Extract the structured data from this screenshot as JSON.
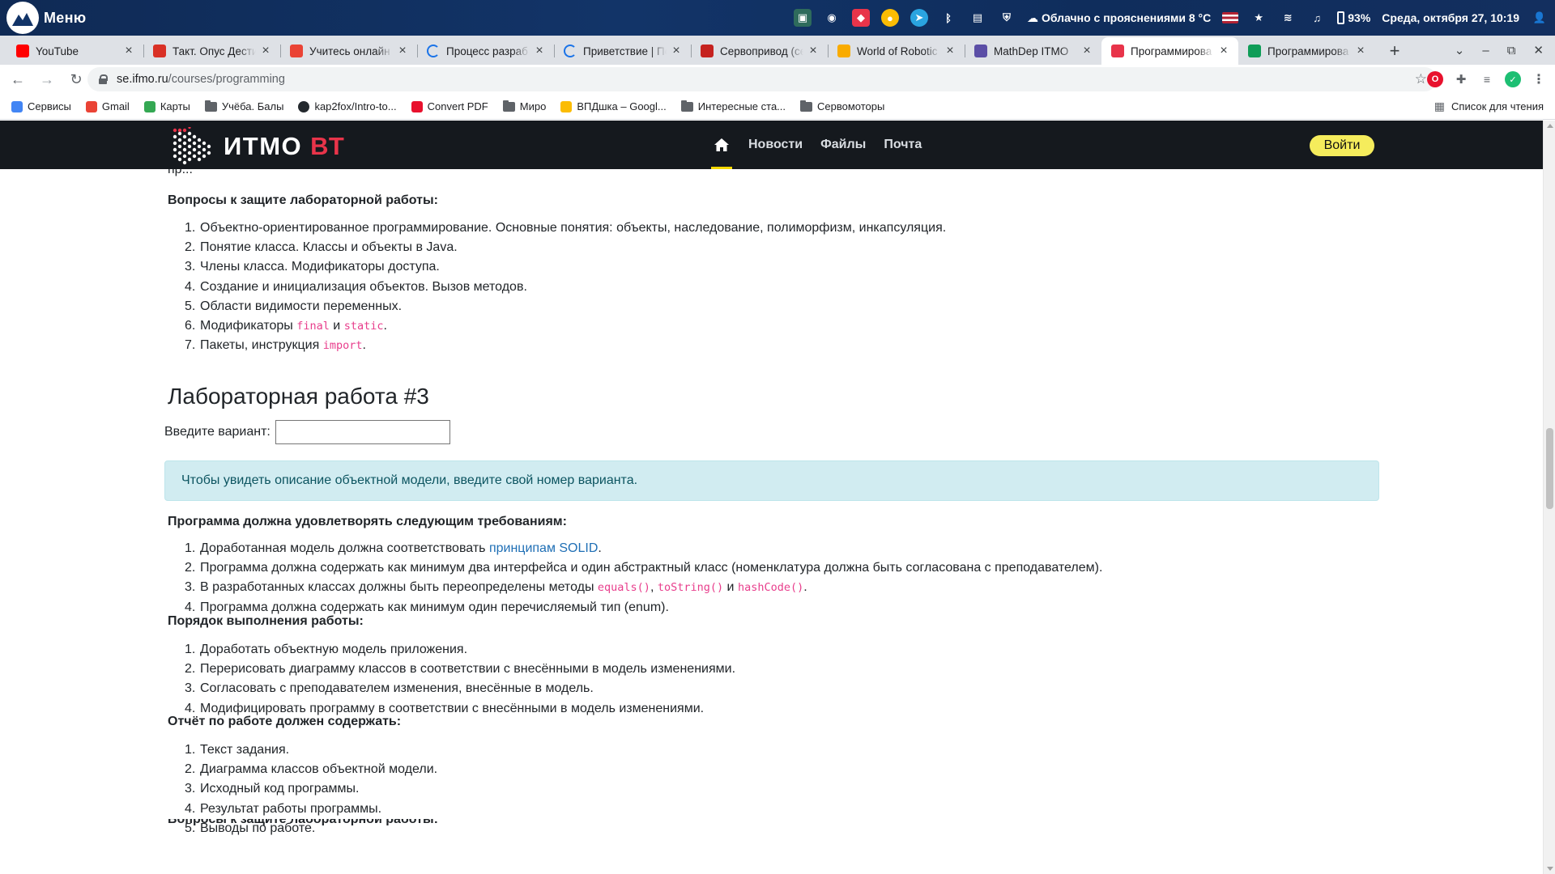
{
  "os": {
    "menu_label": "Меню",
    "weather": "Облачно с прояснениями 8 °C",
    "battery": "93%",
    "datetime": "Среда, октября 27, 10:19"
  },
  "tabs": [
    {
      "title": "YouTube",
      "icon": "youtube-icon",
      "color": "#ff0000"
    },
    {
      "title": "Такт. Опус Дести",
      "icon": "a-icon",
      "color": "#d93025"
    },
    {
      "title": "Учитесь онлайн",
      "icon": "gmail-icon",
      "color": "#ea4335"
    },
    {
      "title": "Процесс разраб",
      "icon": "loading-icon",
      "color": "#1a73e8"
    },
    {
      "title": "Приветствие | По",
      "icon": "loading-icon",
      "color": "#1a73e8"
    },
    {
      "title": "Сервопривод (се",
      "icon": "servo-icon",
      "color": "#c5221f"
    },
    {
      "title": "World of Robotic",
      "icon": "robotics-icon",
      "color": "#f9ab00"
    },
    {
      "title": "MathDep ITMO",
      "icon": "mathdep-icon",
      "color": "#5b4ea6"
    },
    {
      "title": "Программирова",
      "icon": "bt-icon",
      "color": "#e8344a",
      "active": true
    },
    {
      "title": "Программирова",
      "icon": "sheets-icon",
      "color": "#0f9d58"
    }
  ],
  "toolbar": {
    "url_host": "se.ifmo.ru",
    "url_path": "/courses/programming"
  },
  "bookmarks": [
    {
      "label": "Сервисы",
      "icon": "apps-grid-icon"
    },
    {
      "label": "Gmail",
      "icon": "gmail-icon"
    },
    {
      "label": "Карты",
      "icon": "maps-icon"
    },
    {
      "label": "Учёба. Балы",
      "icon": "folder-icon"
    },
    {
      "label": "kap2fox/Intro-to...",
      "icon": "github-icon"
    },
    {
      "label": "Convert PDF",
      "icon": "heart-icon"
    },
    {
      "label": "Миро",
      "icon": "folder-icon"
    },
    {
      "label": "ВПДшка – Googl...",
      "icon": "drive-icon"
    },
    {
      "label": "Интересные ста...",
      "icon": "folder-icon"
    },
    {
      "label": "Сервомоторы",
      "icon": "folder-icon"
    }
  ],
  "reading_list": "Список для чтения",
  "site": {
    "logo_text": "ИТМО",
    "logo_accent": "ВТ",
    "nav": [
      "Новости",
      "Файлы",
      "Почта"
    ],
    "login": "Войти"
  },
  "page": {
    "cut_top": "пр...",
    "defense_title": "Вопросы к защите лабораторной работы:",
    "defense": [
      "Объектно-ориентированное программирование. Основные понятия: объекты, наследование, полиморфизм, инкапсуляция.",
      "Понятие класса. Классы и объекты в Java.",
      "Члены класса. Модификаторы доступа.",
      "Создание и инициализация объектов. Вызов методов.",
      "Области видимости переменных."
    ],
    "defense6": {
      "pre": "Модификаторы ",
      "code1": "final",
      "mid": " и ",
      "code2": "static",
      "post": "."
    },
    "defense7": {
      "pre": "Пакеты, инструкция ",
      "code": "import",
      "post": "."
    },
    "lab_title": "Лабораторная работа #3",
    "variant_label": "Введите вариант:",
    "alert": "Чтобы увидеть описание объектной модели, введите свой номер варианта.",
    "req_title": "Программа должна удовлетворять следующим требованиям:",
    "req1": {
      "pre": "Доработанная модель должна соответствовать ",
      "link": "принципам SOLID",
      "post": "."
    },
    "req2": "Программа должна содержать как минимум два интерфейса и один абстрактный класс (номенклатура должна быть согласована с преподавателем).",
    "req3": {
      "pre": "В разработанных классах должны быть переопределены методы ",
      "c1": "equals()",
      "sep1": ", ",
      "c2": "toString()",
      "sep2": " и ",
      "c3": "hashCode()",
      "post": "."
    },
    "req4": "Программа должна содержать как минимум один перечисляемый тип (enum).",
    "order_title": "Порядок выполнения работы:",
    "order": [
      "Доработать объектную модель приложения.",
      "Перерисовать диаграмму классов в соответствии с внесёнными в модель изменениями.",
      "Согласовать с преподавателем изменения, внесённые в модель.",
      "Модифицировать программу в соответствии с внесёнными в модель изменениями."
    ],
    "report_title": "Отчёт по работе должен содержать:",
    "report": [
      "Текст задания.",
      "Диаграмма классов объектной модели.",
      "Исходный код программы.",
      "Результат работы программы.",
      "Выводы по работе."
    ],
    "cut_bottom": "Вопросы к защите лабораторной работы:"
  }
}
